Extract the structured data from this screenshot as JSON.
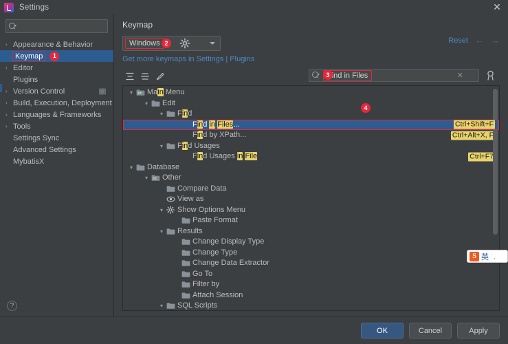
{
  "window": {
    "title": "Settings",
    "app_icon": "intellij-idea-icon",
    "close_label": "✕"
  },
  "sidebar": {
    "search": {
      "value": "",
      "placeholder": ""
    },
    "items": [
      {
        "label": "Appearance & Behavior",
        "expandable": true,
        "selected": false
      },
      {
        "label": "Keymap",
        "expandable": false,
        "selected": true,
        "badge": "1"
      },
      {
        "label": "Editor",
        "expandable": true,
        "selected": false
      },
      {
        "label": "Plugins",
        "expandable": false,
        "selected": false
      },
      {
        "label": "Version Control",
        "expandable": true,
        "selected": false,
        "trailing_icon": "module-icon"
      },
      {
        "label": "Build, Execution, Deployment",
        "expandable": true,
        "selected": false
      },
      {
        "label": "Languages & Frameworks",
        "expandable": true,
        "selected": false
      },
      {
        "label": "Tools",
        "expandable": true,
        "selected": false
      },
      {
        "label": "Settings Sync",
        "expandable": false,
        "selected": false
      },
      {
        "label": "Advanced Settings",
        "expandable": false,
        "selected": false
      },
      {
        "label": "MybatisX",
        "expandable": false,
        "selected": false
      }
    ],
    "help_label": "?"
  },
  "main": {
    "panel_title": "Keymap",
    "reset_label": "Reset",
    "back_arrow": "←",
    "forward_arrow": "→",
    "keymap_select": {
      "value": "Windows",
      "badge": "2"
    },
    "gear_icon": "gear-icon",
    "keymap_link": "Get more keymaps in Settings | Plugins",
    "toolbar": {
      "expand_all_icon": "expand-all-icon",
      "collapse_all_icon": "collapse-all-icon",
      "edit_shortcut_icon": "edit-pencil-icon"
    },
    "search": {
      "value": "Find in Files",
      "badge": "3",
      "clear_label": "✕",
      "filter_icon": "find-by-shortcut-icon"
    },
    "tree_badge_4": "4"
  },
  "tree": {
    "rows": [
      {
        "indent": 0,
        "twisty": "▾",
        "icon": "main-menu-icon",
        "parts": [
          {
            "t": "Ma",
            "h": false
          },
          {
            "t": "in",
            "h": true
          },
          {
            "t": " Menu",
            "h": false
          }
        ],
        "shortcut": "",
        "selected": false
      },
      {
        "indent": 1,
        "twisty": "▾",
        "icon": "folder-icon",
        "parts": [
          {
            "t": "Edit",
            "h": false
          }
        ],
        "shortcut": "",
        "selected": false
      },
      {
        "indent": 2,
        "twisty": "▾",
        "icon": "folder-icon",
        "parts": [
          {
            "t": "F",
            "h": false
          },
          {
            "t": "in",
            "h": true
          },
          {
            "t": "d",
            "h": false
          }
        ],
        "shortcut": "",
        "selected": false
      },
      {
        "indent": 3,
        "twisty": "",
        "icon": "",
        "parts": [
          {
            "t": "F",
            "h": false
          },
          {
            "t": "in",
            "h": true
          },
          {
            "t": "d ",
            "h": false
          },
          {
            "t": "in",
            "h": true
          },
          {
            "t": " ",
            "h": false
          },
          {
            "t": "Files",
            "h": true
          },
          {
            "t": "...",
            "h": false
          }
        ],
        "shortcut": "Ctrl+Shift+F",
        "selected": true,
        "outlined": true
      },
      {
        "indent": 3,
        "twisty": "",
        "icon": "",
        "parts": [
          {
            "t": "F",
            "h": false
          },
          {
            "t": "in",
            "h": true
          },
          {
            "t": "d by XPath...",
            "h": false
          }
        ],
        "shortcut": "Ctrl+Alt+X, F",
        "selected": false
      },
      {
        "indent": 2,
        "twisty": "▾",
        "icon": "folder-icon",
        "parts": [
          {
            "t": "F",
            "h": false
          },
          {
            "t": "in",
            "h": true
          },
          {
            "t": "d Usages",
            "h": false
          }
        ],
        "shortcut": "",
        "selected": false
      },
      {
        "indent": 3,
        "twisty": "",
        "icon": "",
        "parts": [
          {
            "t": "F",
            "h": false
          },
          {
            "t": "in",
            "h": true
          },
          {
            "t": "d Usages ",
            "h": false
          },
          {
            "t": "in",
            "h": true
          },
          {
            "t": " ",
            "h": false
          },
          {
            "t": "File",
            "h": true
          }
        ],
        "shortcut": "Ctrl+F7",
        "selected": false
      },
      {
        "indent": 0,
        "twisty": "▾",
        "icon": "folder-icon",
        "parts": [
          {
            "t": "Database",
            "h": false
          }
        ],
        "shortcut": "",
        "selected": false
      },
      {
        "indent": 1,
        "twisty": "▾",
        "icon": "main-menu-icon",
        "parts": [
          {
            "t": "Other",
            "h": false
          }
        ],
        "shortcut": "",
        "selected": false
      },
      {
        "indent": 2,
        "twisty": "",
        "icon": "folder-icon",
        "parts": [
          {
            "t": "Compare Data",
            "h": false
          }
        ],
        "shortcut": "",
        "selected": false
      },
      {
        "indent": 2,
        "twisty": "",
        "icon": "eye-icon",
        "parts": [
          {
            "t": "View as",
            "h": false
          }
        ],
        "shortcut": "",
        "selected": false
      },
      {
        "indent": 2,
        "twisty": "▾",
        "icon": "gear-icon",
        "parts": [
          {
            "t": "Show Options Menu",
            "h": false
          }
        ],
        "shortcut": "",
        "selected": false
      },
      {
        "indent": 3,
        "twisty": "",
        "icon": "folder-icon",
        "parts": [
          {
            "t": "Paste Format",
            "h": false
          }
        ],
        "shortcut": "",
        "selected": false
      },
      {
        "indent": 2,
        "twisty": "▾",
        "icon": "folder-icon",
        "parts": [
          {
            "t": "Results",
            "h": false
          }
        ],
        "shortcut": "",
        "selected": false
      },
      {
        "indent": 3,
        "twisty": "",
        "icon": "folder-icon",
        "parts": [
          {
            "t": "Change Display Type",
            "h": false
          }
        ],
        "shortcut": "",
        "selected": false
      },
      {
        "indent": 3,
        "twisty": "",
        "icon": "folder-icon",
        "parts": [
          {
            "t": "Change Type",
            "h": false
          }
        ],
        "shortcut": "",
        "selected": false
      },
      {
        "indent": 3,
        "twisty": "",
        "icon": "folder-icon",
        "parts": [
          {
            "t": "Change Data Extractor",
            "h": false
          }
        ],
        "shortcut": "",
        "selected": false
      },
      {
        "indent": 3,
        "twisty": "",
        "icon": "folder-icon",
        "parts": [
          {
            "t": "Go To",
            "h": false
          }
        ],
        "shortcut": "",
        "selected": false
      },
      {
        "indent": 3,
        "twisty": "",
        "icon": "folder-icon",
        "parts": [
          {
            "t": "Filter by",
            "h": false
          }
        ],
        "shortcut": "",
        "selected": false
      },
      {
        "indent": 3,
        "twisty": "",
        "icon": "folder-icon",
        "parts": [
          {
            "t": "Attach Session",
            "h": false
          }
        ],
        "shortcut": "",
        "selected": false
      },
      {
        "indent": 2,
        "twisty": "▾",
        "icon": "folder-icon",
        "parts": [
          {
            "t": "SQL Scripts",
            "h": false
          }
        ],
        "shortcut": "",
        "selected": false
      }
    ]
  },
  "footer": {
    "ok_label": "OK",
    "cancel_label": "Cancel",
    "apply_label": "Apply"
  },
  "ime": {
    "logo": "S",
    "mode": "英",
    "dots": "˙,"
  },
  "colors": {
    "accent_blue": "#2d5c91",
    "link_blue": "#4a88c7",
    "badge_red": "#e8273a",
    "highlight_yellow": "#e8d36b",
    "bg": "#3c3f41",
    "ok_button": "#365880"
  }
}
